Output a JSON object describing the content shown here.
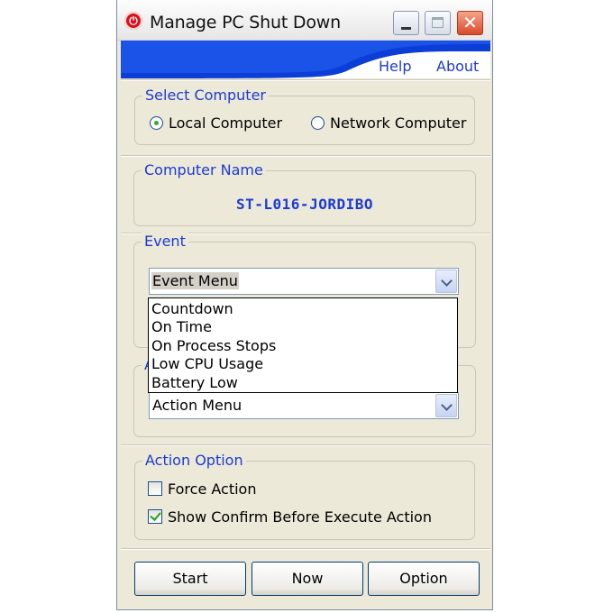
{
  "window": {
    "title": "Manage PC Shut Down",
    "app_icon": "power-icon",
    "controls": [
      "minimize-icon",
      "maximize-icon",
      "close-icon"
    ]
  },
  "menu": {
    "help": "Help",
    "about": "About"
  },
  "select_computer": {
    "label": "Select Computer",
    "options": [
      "Local Computer",
      "Network Computer"
    ],
    "selected": "Local Computer"
  },
  "computer_name": {
    "label": "Computer Name",
    "value": "ST-L016-JORDIBO"
  },
  "event": {
    "label": "Event",
    "selected": "Event Menu",
    "options": [
      "Countdown",
      "On Time",
      "On Process Stops",
      "Low CPU Usage",
      "Battery Low"
    ]
  },
  "action": {
    "label_partial": "A",
    "selected": "Action Menu"
  },
  "action_option": {
    "label": "Action Option",
    "force_action": {
      "label": "Force Action",
      "checked": false
    },
    "confirm": {
      "label": "Show Confirm Before Execute Action",
      "checked": true
    }
  },
  "buttons": {
    "start": "Start",
    "now": "Now",
    "option": "Option"
  },
  "colors": {
    "accent": "#1c3bd2",
    "banner": "#0a3ed6",
    "window_bg": "#ece9d8"
  }
}
